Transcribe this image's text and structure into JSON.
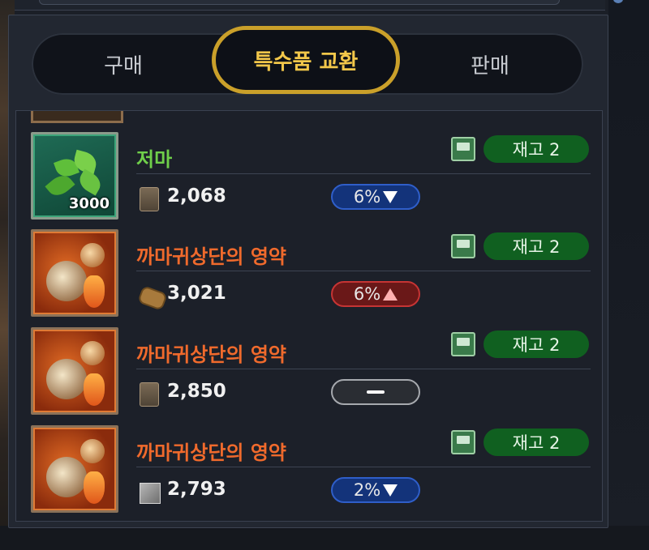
{
  "tabs": [
    {
      "label": "구매"
    },
    {
      "label": "특수품 교환"
    },
    {
      "label": "판매"
    }
  ],
  "items": [
    {
      "name": "저마",
      "quantity": "3000",
      "stock": "재고 2",
      "cost": "2,068",
      "cost_icon": "stone-icon",
      "change": "6%",
      "trend": "down"
    },
    {
      "name": "까마귀상단의 영약",
      "quantity": "",
      "stock": "재고 2",
      "cost": "3,021",
      "cost_icon": "log-icon",
      "change": "6%",
      "trend": "up"
    },
    {
      "name": "까마귀상단의 영약",
      "quantity": "",
      "stock": "재고 2",
      "cost": "2,850",
      "cost_icon": "stone-icon",
      "change": "",
      "trend": "flat"
    },
    {
      "name": "까마귀상단의 영약",
      "quantity": "",
      "stock": "재고 2",
      "cost": "2,793",
      "cost_icon": "box-icon",
      "change": "2%",
      "trend": "down"
    }
  ],
  "colors": {
    "active_tab": "#f2c74a",
    "tab_ring": "#caa02a",
    "green_name": "#6fcf4a",
    "orange_name": "#f06a2c",
    "stock_badge": "#106020",
    "trend_down": "#2f5ec9",
    "trend_up": "#c63434"
  }
}
